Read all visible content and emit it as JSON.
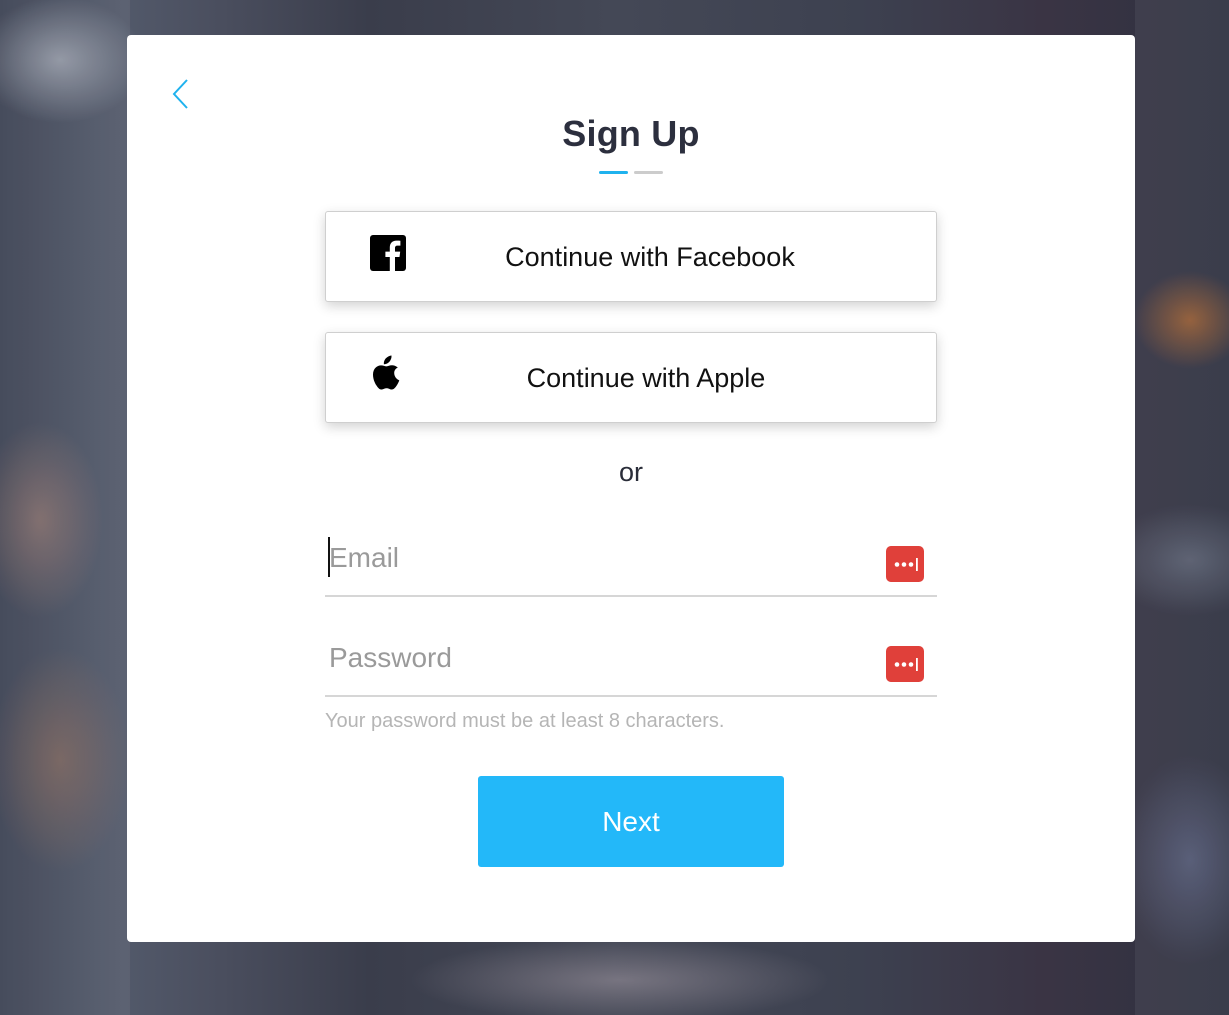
{
  "colors": {
    "accent": "#1fb2ee",
    "next_button": "#23b8f9",
    "password_manager": "#e0403a",
    "title": "#2c2f3e"
  },
  "modal": {
    "title": "Sign Up",
    "back_icon": "chevron-left-icon",
    "steps": {
      "current": 1,
      "total": 2
    }
  },
  "social": {
    "facebook": {
      "label": "Continue with Facebook",
      "icon": "facebook-icon"
    },
    "apple": {
      "label": "Continue with Apple",
      "icon": "apple-icon"
    }
  },
  "divider": {
    "text": "or"
  },
  "form": {
    "email": {
      "placeholder": "Email",
      "value": "",
      "icon": "password-manager-icon"
    },
    "password": {
      "placeholder": "Password",
      "value": "",
      "icon": "password-manager-icon"
    },
    "password_hint": "Your password must be at least 8 characters.",
    "next_label": "Next"
  }
}
